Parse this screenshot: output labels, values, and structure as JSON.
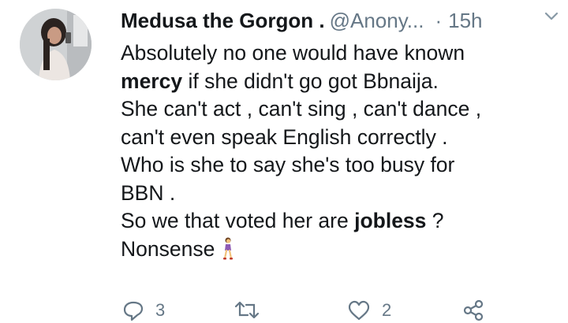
{
  "tweet": {
    "author_name": "Medusa the Gorgon .",
    "handle": "@Anony...",
    "separator": "·",
    "time": "15h",
    "menu_icon": "chevron-down-icon",
    "body": {
      "line1": "Absolutely no one would have known",
      "mention_bold": "mercy",
      "line2_rest": " if she didn't go got Bbnaija.",
      "line3": "She can't act , can't sing , can't dance ,",
      "line4": "can't even speak English correctly .",
      "line5": "Who is she to say she's too busy for",
      "line6": "BBN .",
      "line7_start": "So we that voted her are ",
      "jobless_bold": "jobless",
      "line7_end": " ?",
      "line8": "Nonsense",
      "emoji": "woman-walking-emoji"
    },
    "actions": {
      "reply_count": "3",
      "retweet_count": "",
      "like_count": "2",
      "share_icon": "share-icon"
    }
  }
}
